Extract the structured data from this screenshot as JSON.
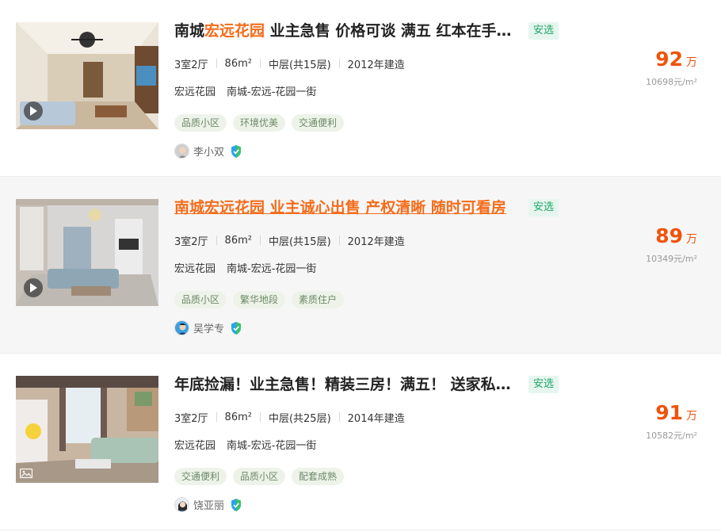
{
  "listings": [
    {
      "title_highlight_prefix": "南城",
      "title_highlight": "宏远花园",
      "title_rest": " 业主急售 价格可谈 满五 红本在手 随时看房",
      "badge": "安选",
      "layout": "3室2厅",
      "area": "86m²",
      "floor": "中层(共15层)",
      "built": "2012年建造",
      "community": "宏远花园",
      "location": "南城-宏远-花园一街",
      "tags": [
        "品质小区",
        "环境优美",
        "交通便利"
      ],
      "agent": "李小双",
      "price": "92",
      "price_unit": "万",
      "unit_price": "10698元/m²",
      "media": "video"
    },
    {
      "title_full": "南城宏远花园 业主诚心出售 产权清晰 随时可看房",
      "badge": "安选",
      "layout": "3室2厅",
      "area": "86m²",
      "floor": "中层(共15层)",
      "built": "2012年建造",
      "community": "宏远花园",
      "location": "南城-宏远-花园一街",
      "tags": [
        "品质小区",
        "繁华地段",
        "素质住户"
      ],
      "agent": "吴学专",
      "price": "89",
      "price_unit": "万",
      "unit_price": "10349元/m²",
      "media": "video"
    },
    {
      "title_full": "年底捡漏！业主急售！精装三房！满五！ 送家私家电",
      "badge": "安选",
      "layout": "3室2厅",
      "area": "86m²",
      "floor": "中层(共25层)",
      "built": "2014年建造",
      "community": "宏远花园",
      "location": "南城-宏远-花园一街",
      "tags": [
        "交通便利",
        "品质小区",
        "配套成熟"
      ],
      "agent": "饶亚丽",
      "price": "91",
      "price_unit": "万",
      "unit_price": "10582元/m²",
      "media": "photo"
    }
  ],
  "colors": {
    "accent": "#f56c1a",
    "price": "#f0530a",
    "badge_text": "#1fa66a",
    "badge_bg": "#e6f6ee",
    "tag_bg": "#eef3ea",
    "hover_bg": "#f6f6f6"
  },
  "icons": {
    "play": "play-icon",
    "photo": "photo-icon",
    "verified": "verified-shield-icon"
  }
}
